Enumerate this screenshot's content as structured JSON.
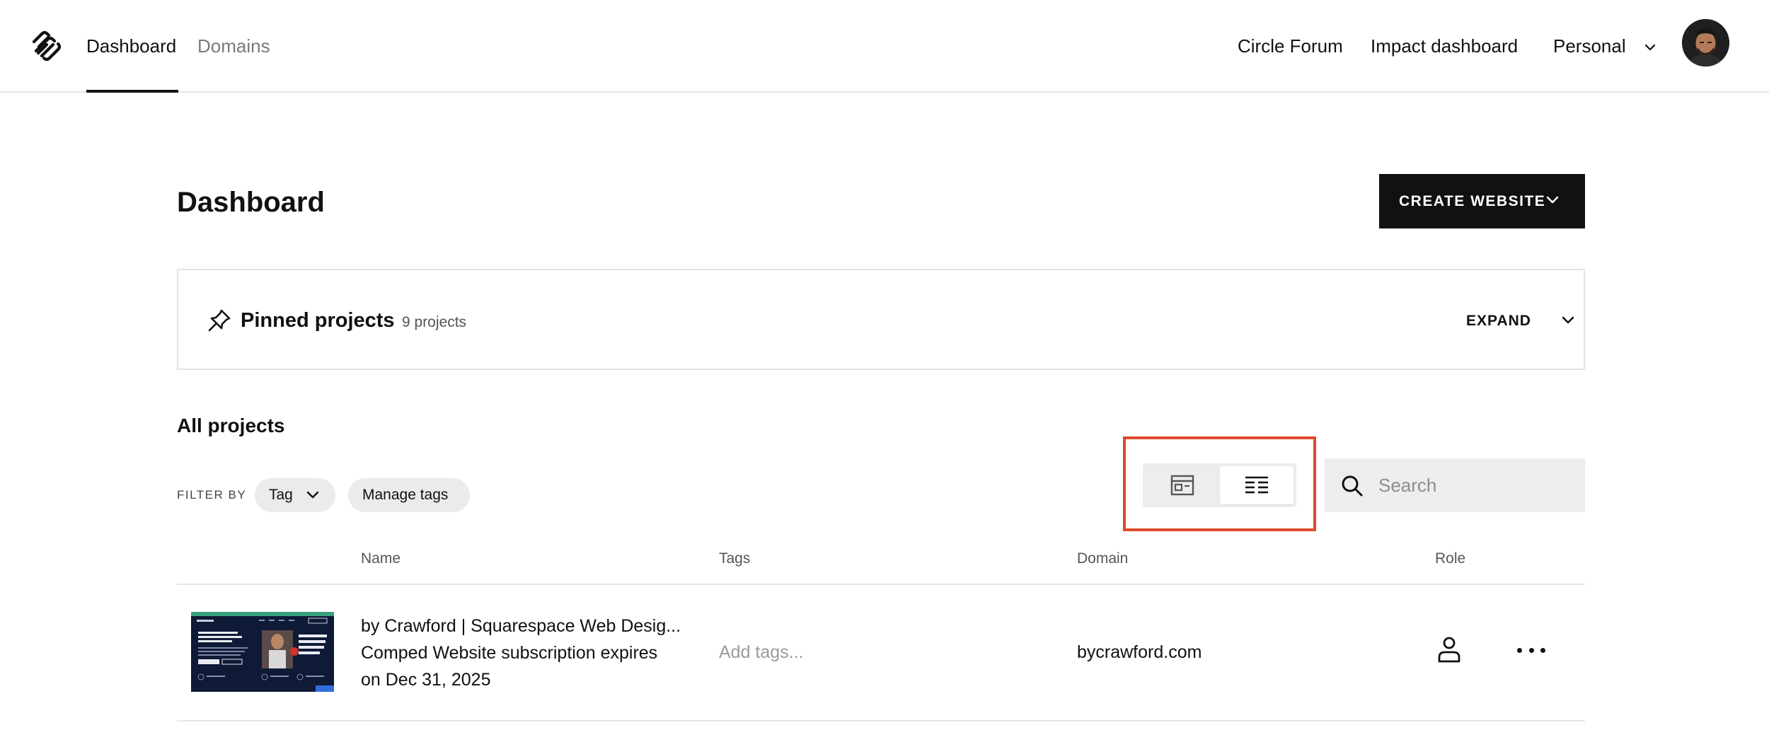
{
  "nav": {
    "tabs": [
      {
        "label": "Dashboard",
        "active": true
      },
      {
        "label": "Domains",
        "active": false
      }
    ],
    "links": {
      "circle_forum": "Circle Forum",
      "impact_dashboard": "Impact dashboard",
      "account": "Personal"
    }
  },
  "main": {
    "title": "Dashboard",
    "create_button": "CREATE WEBSITE",
    "pinned": {
      "title": "Pinned projects",
      "count": "9 projects",
      "expand_label": "EXPAND"
    },
    "all_projects": "All projects",
    "filter": {
      "label": "FILTER BY",
      "tag_label": "Tag",
      "manage_tags_label": "Manage tags"
    },
    "search": {
      "placeholder": "Search"
    },
    "table": {
      "headers": {
        "name": "Name",
        "tags": "Tags",
        "domain": "Domain",
        "role": "Role"
      },
      "rows": [
        {
          "name": "by Crawford | Squarespace Web Desig...",
          "subscription_line1": "Comped Website subscription expires",
          "subscription_line2": "on Dec 31, 2025",
          "tags_placeholder": "Add tags...",
          "domain": "bycrawford.com"
        }
      ]
    }
  },
  "colors": {
    "accent_highlight": "#e0492d",
    "primary": "#111111",
    "muted_bg": "#ededed"
  },
  "icons": [
    "squarespace-logo",
    "chevron-down-icon",
    "pin-icon",
    "grid-view-icon",
    "list-view-icon",
    "search-icon",
    "person-icon",
    "more-icon"
  ]
}
